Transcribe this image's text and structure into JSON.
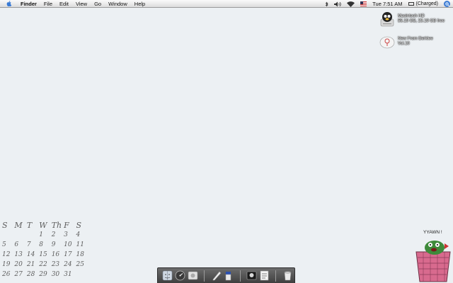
{
  "menubar": {
    "apple_icon": "apple-logo-icon",
    "app_name": "Finder",
    "items": [
      "File",
      "Edit",
      "View",
      "Go",
      "Window",
      "Help"
    ],
    "clock": "Tue 7:51 AM",
    "battery": "(Charged)",
    "status_icons": [
      "bluetooth-icon",
      "volume-icon",
      "wifi-icon",
      "flag-icon"
    ],
    "accent": "#1d5fc4"
  },
  "desktop": {
    "background": "#ecf0f3",
    "icons": [
      {
        "name": "Macintosh HD",
        "detail": "55.19 GB, 23.19 GB free",
        "icon": "hard-drive-icon"
      },
      {
        "name": "New From Berklee",
        "detail": "Vol.10",
        "icon": "disc-icon"
      }
    ]
  },
  "calendar": {
    "days": [
      "S",
      "M",
      "T",
      "W",
      "Th",
      "F",
      "S"
    ],
    "weeks": [
      [
        "",
        "",
        "",
        "1",
        "2",
        "3",
        "4"
      ],
      [
        "5",
        "6",
        "7",
        "8",
        "9",
        "10",
        "11"
      ],
      [
        "12",
        "13",
        "14",
        "15",
        "16",
        "17",
        "18"
      ],
      [
        "19",
        "20",
        "21",
        "22",
        "23",
        "24",
        "25"
      ],
      [
        "26",
        "27",
        "28",
        "29",
        "30",
        "31",
        ""
      ]
    ]
  },
  "dock": {
    "items": [
      "finder-icon",
      "dashboard-icon",
      "app-icon",
      "pencil-icon",
      "glass-icon",
      "terminal-icon",
      "document-icon",
      "trash-icon"
    ]
  },
  "cartoon": {
    "caption": "YYAWN !"
  }
}
